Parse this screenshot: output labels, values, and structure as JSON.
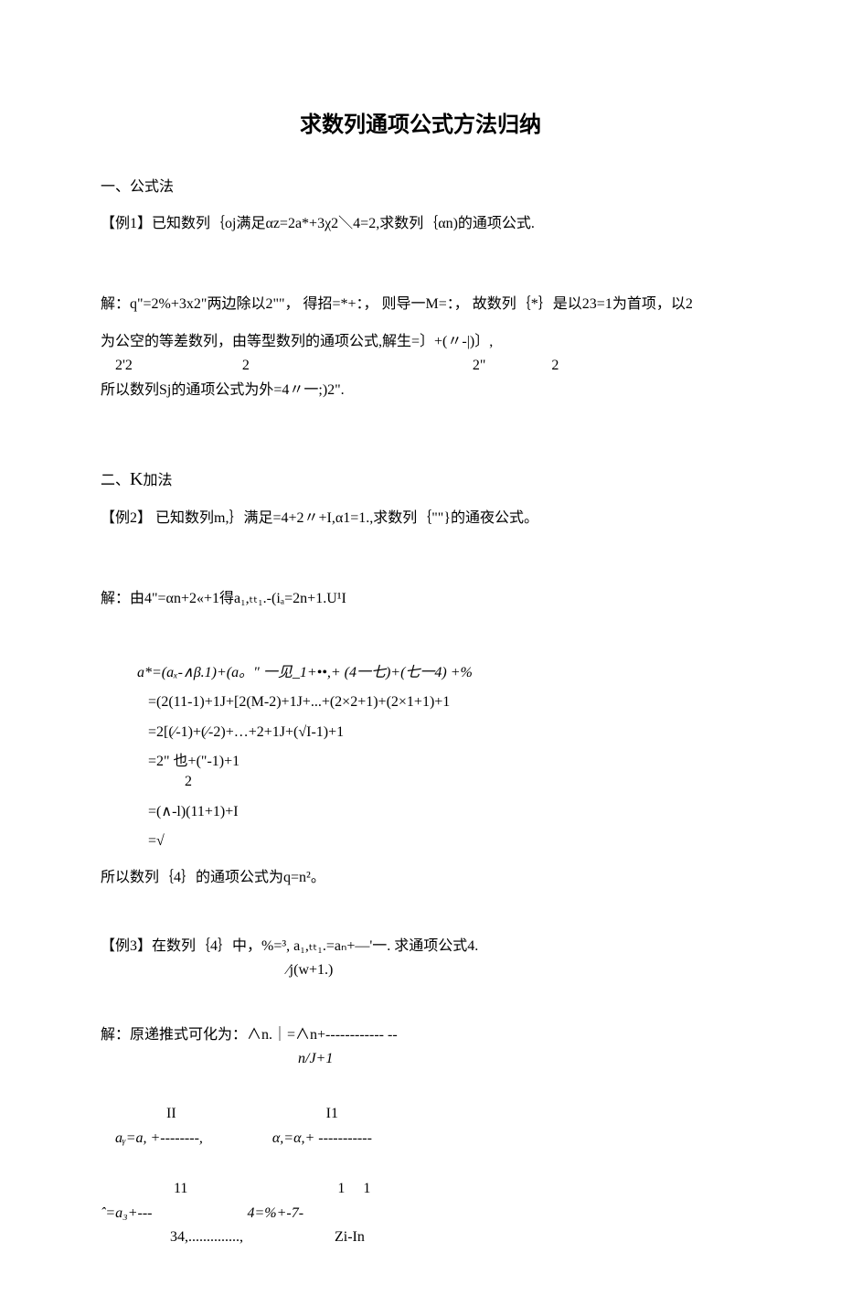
{
  "title": "求数列通项公式方法归纳",
  "s1": {
    "heading": "一、公式法",
    "ex1_label": "【例1】已知数列｛oj满足αz=2a*+3χ2＼4=2,求数列｛αn)的通项公式.",
    "sol_p1": "解：q\"=2%+3x2\"两边除以2\"\"，  得招=*+：， 则导一M=：， 故数列｛*｝是以23=1为首项，以2",
    "sol_p2": "为公空的等差数列，由等型数列的通项公式,解生=〕+(〃-|)〕,",
    "sol_p2_line2a": "    2'2                              2                                                             2\"                  2",
    "sol_p3": "所以数列Sj的通项公式为外=4〃一;)2\"."
  },
  "s2": {
    "heading_pre": "二、",
    "heading_k": "K",
    "heading_post": "加法",
    "ex2_label": "【例2】   已知数列m,｝满足=4+2〃+I,α1=1.,求数列｛\"\"}的通夜公式。",
    "sol_intro": "解：由4\"=αn+2«+1得a₁,ₜₜ₁.-(iₐ=2n+1.U¹I",
    "d1": "a*=(aₓ-∧β.1)+(a。\" 一见_1+••,+ (4一七)+(七一4) +%",
    "d2": "   =(2(11-1)+1J+[2(M-2)+1J+...+(2×2+1)+(2×1+1)+1",
    "d3": "   =2[(∕-1)+(∕-2)+…+2+1J+(√I-1)+1",
    "d4a": "   =2\" 也+(\"-1)+1",
    "d4b": "             2",
    "d5": "   =(∧-l)(11+1)+I",
    "d6": "   =√",
    "concl": "所以数列｛4｝的通项公式为q=n²。",
    "ex3_line1": "【例3】在数列｛4｝中，%=³, a₁,ₜₜ₁.=aₙ+—'一. 求通项公式4.",
    "ex3_line2": "                                                   ∕j(w+1.)",
    "sol3_a": "解：原递推式可化为：∧n.｜=∧n+------------ --",
    "sol3_b": "                                                      n/J+1",
    "row1_a": "                  II                                         I1",
    "row1_b": "    aᵧ=a, +--------,                   α,=α,+ -----------",
    "row2_a": "                    11                                         1     1",
    "row2_b": "ˆ=a₃+---                          4=%+-7- ",
    "row2_c": "                   34,..............,                         Zi-In"
  }
}
